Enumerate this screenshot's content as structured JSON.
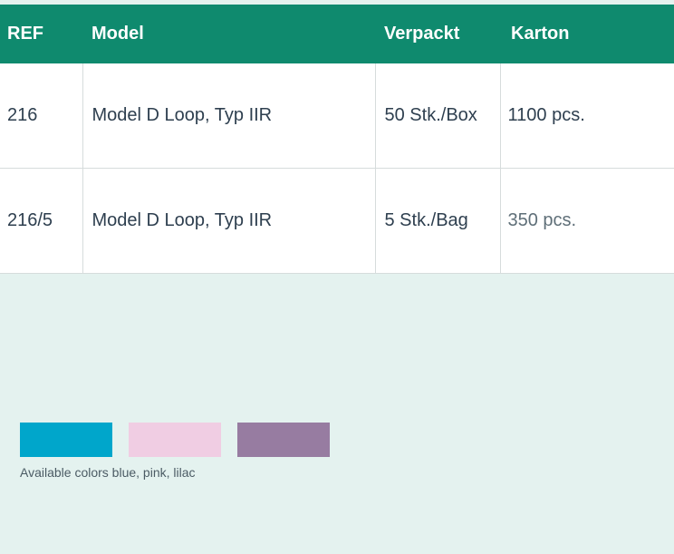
{
  "table": {
    "headers": {
      "ref": "REF",
      "model": "Model",
      "verpackt": "Verpackt",
      "karton": "Karton"
    },
    "rows": [
      {
        "ref": "216",
        "model": "Model D Loop, Typ IIR",
        "verpackt": "50 Stk./Box",
        "karton": "1100 pcs."
      },
      {
        "ref": "216/5",
        "model": "Model D Loop, Typ IIR",
        "verpackt": "5 Stk./Bag",
        "karton": "350 pcs."
      }
    ]
  },
  "colors": {
    "header_bg": "#0f8a6e",
    "page_bg": "#e4f2ef",
    "swatches": [
      {
        "name": "blue",
        "hex": "#00a6cb"
      },
      {
        "name": "pink",
        "hex": "#f0cde3"
      },
      {
        "name": "lilac",
        "hex": "#977ca1"
      }
    ]
  },
  "caption": "Available colors blue, pink, lilac"
}
